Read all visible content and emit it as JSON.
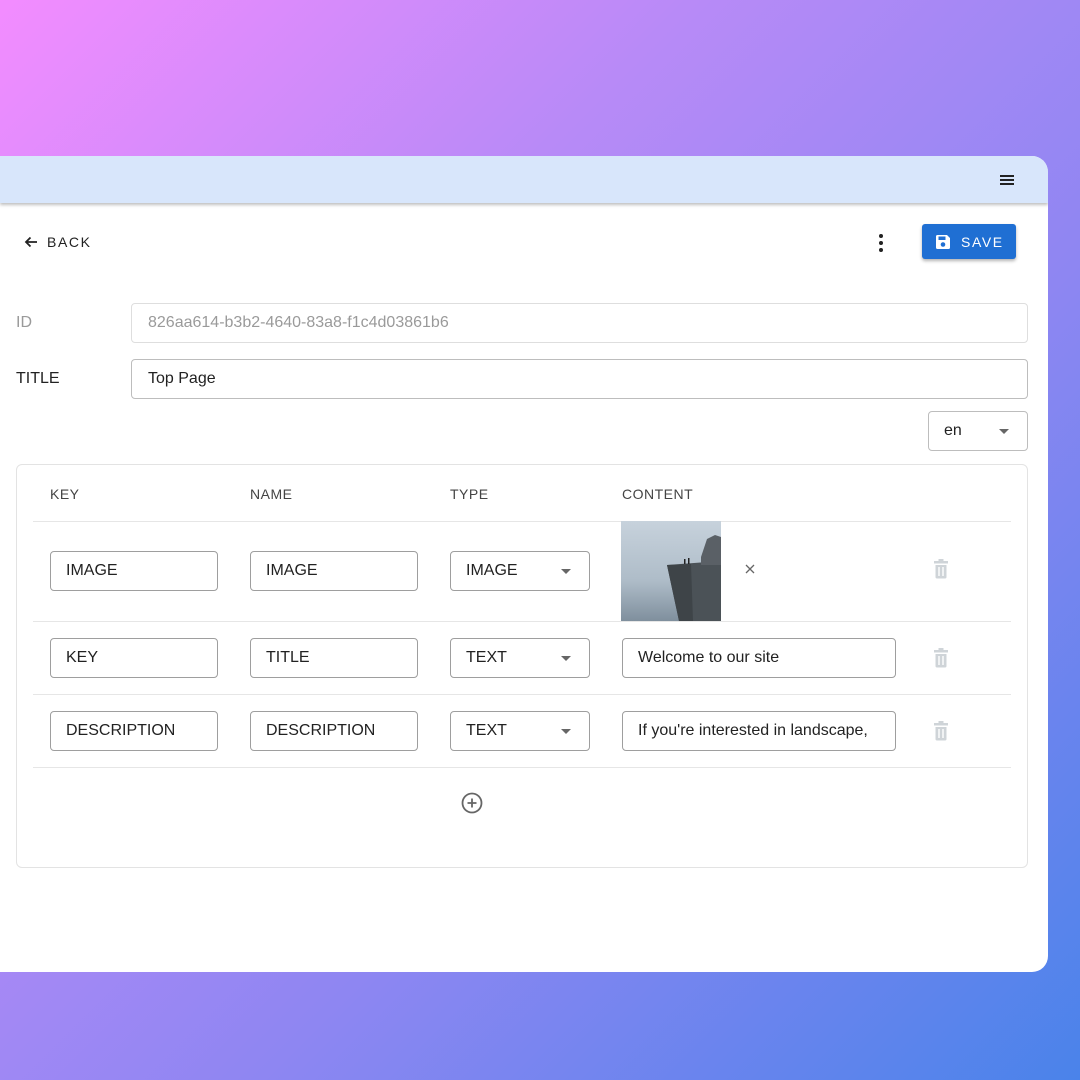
{
  "back_label": "BACK",
  "save_label": "SAVE",
  "fields": {
    "id": {
      "label": "ID",
      "value": "826aa614-b3b2-4640-83a8-f1c4d03861b6"
    },
    "title": {
      "label": "TITLE",
      "value": "Top Page"
    }
  },
  "language": {
    "selected": "en"
  },
  "table": {
    "headers": {
      "key": "KEY",
      "name": "NAME",
      "type": "TYPE",
      "content": "CONTENT"
    },
    "rows": [
      {
        "key": "IMAGE",
        "name": "IMAGE",
        "type": "IMAGE",
        "content": ""
      },
      {
        "key": "KEY",
        "name": "TITLE",
        "type": "TEXT",
        "content": "Welcome to our site"
      },
      {
        "key": "DESCRIPTION",
        "name": "DESCRIPTION",
        "type": "TEXT",
        "content": "If you're interested in landscape,"
      }
    ]
  },
  "colors": {
    "accent": "#1f6fd3",
    "appbar": "#d8e6fb"
  },
  "icons": {
    "menu": "menu-icon",
    "back": "arrow-left-icon",
    "more": "more-vert-icon",
    "save": "floppy-disk-icon",
    "remove": "close-icon",
    "delete": "trash-icon",
    "add": "add-circle-icon"
  }
}
